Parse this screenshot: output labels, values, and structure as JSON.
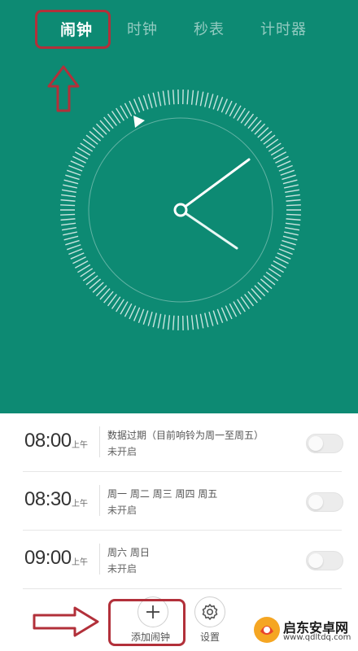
{
  "tabs": [
    {
      "label": "闹钟",
      "active": true
    },
    {
      "label": "时钟",
      "active": false
    },
    {
      "label": "秒表",
      "active": false
    },
    {
      "label": "计时器",
      "active": false
    }
  ],
  "colors": {
    "header_bg": "#0d8a73",
    "annotation": "#b2303a",
    "divider": "#e6e6e6",
    "toggle_off": "#ececec"
  },
  "clock": {
    "hour_hand": "08:00 position",
    "icons": [
      "play-triangle-icon"
    ]
  },
  "alarms": [
    {
      "time": "08:00",
      "ampm": "上午",
      "repeat": "数据过期（目前响铃为周一至周五）",
      "status": "未开启",
      "enabled": false
    },
    {
      "time": "08:30",
      "ampm": "上午",
      "repeat": "周一 周二 周三 周四 周五",
      "status": "未开启",
      "enabled": false
    },
    {
      "time": "09:00",
      "ampm": "上午",
      "repeat": "周六 周日",
      "status": "未开启",
      "enabled": false
    }
  ],
  "bottom": {
    "add_label": "添加闹钟",
    "settings_label": "设置",
    "add_icon": "plus-icon",
    "settings_icon": "gear-icon"
  },
  "watermark": {
    "name": "启东安卓网",
    "url": "www.qdltdq.com"
  }
}
